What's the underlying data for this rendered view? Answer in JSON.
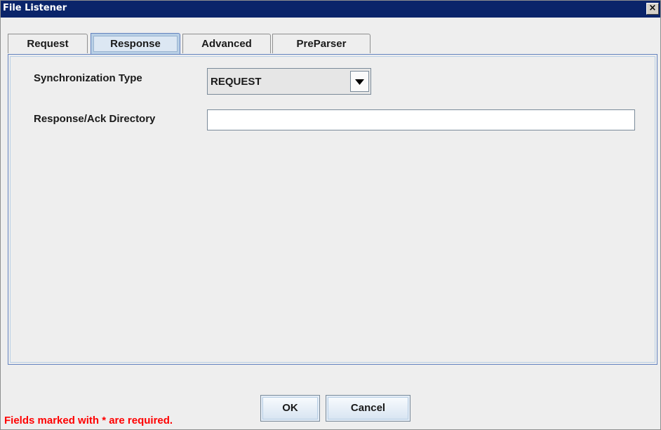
{
  "window": {
    "title": "File Listener",
    "close_glyph": "×"
  },
  "tabs": [
    {
      "label": "Request",
      "selected": false
    },
    {
      "label": "Response",
      "selected": true
    },
    {
      "label": "Advanced",
      "selected": false
    },
    {
      "label": "PreParser",
      "selected": false
    }
  ],
  "form": {
    "sync_type_label": "Synchronization Type",
    "sync_type_value": "REQUEST",
    "response_dir_label": "Response/Ack Directory",
    "response_dir_value": ""
  },
  "buttons": {
    "ok_label": "OK",
    "cancel_label": "Cancel"
  },
  "footer": {
    "required_note": "Fields marked with * are required.",
    "note_color": "#ff0000"
  },
  "colors": {
    "titlebar": "#0a246a",
    "selected_tab": "#b8cfe5"
  }
}
